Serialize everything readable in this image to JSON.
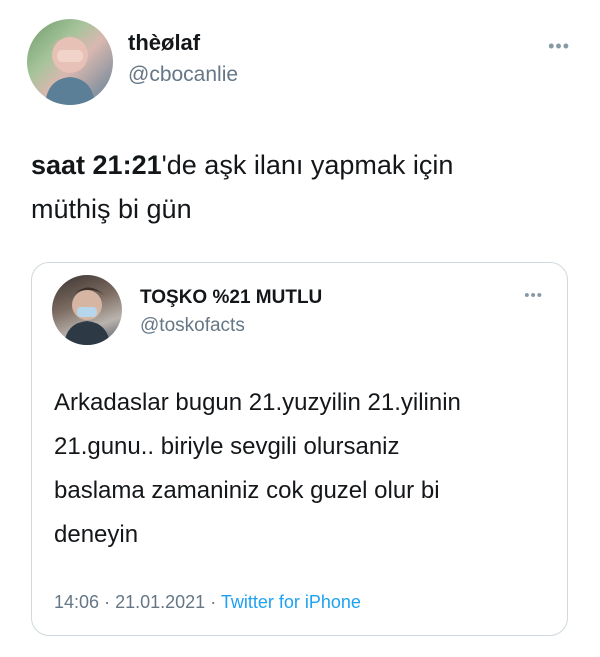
{
  "author": {
    "name": "thèølaf",
    "handle": "@cbocanlie"
  },
  "more_glyph": "•••",
  "tweet": {
    "text_bold": "saat 21:21",
    "text_rest": "'de aşk ilanı yapmak için",
    "text_line2": "müthiş bi gün"
  },
  "quoted": {
    "name": "TOŞKO %21 MUTLU",
    "handle": "@toskofacts",
    "lines": [
      "Arkadaslar bugun 21.yuzyilin 21.yilinin",
      "21.gunu.. biriyle sevgili olursaniz",
      "baslama zamaniniz cok guzel olur bi",
      "deneyin"
    ],
    "time": "14:06",
    "date": "21.01.2021",
    "separator": "·",
    "source": "Twitter for iPhone"
  },
  "colors": {
    "text": "#14171a",
    "secondary": "#657786",
    "link": "#1da1f2",
    "border": "#cfd9de"
  },
  "icons": {
    "more": "more-icon"
  }
}
